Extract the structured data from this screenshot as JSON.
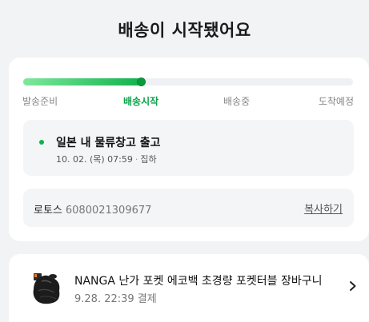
{
  "header": {
    "title": "배송이 시작됐어요"
  },
  "progress": {
    "value": 0.36,
    "steps": [
      "발송준비",
      "배송시작",
      "배송중",
      "도착예정"
    ],
    "active_index": 1,
    "accent_color": "#10b24c"
  },
  "event": {
    "title": "일본 내 물류창고 출고",
    "datetime": "10. 02. (목) 07:59",
    "separator": "·",
    "status": "집하"
  },
  "tracking": {
    "carrier": "로토스",
    "number": "6080021309677",
    "copy_label": "복사하기"
  },
  "order_item": {
    "name": "NANGA 난가 포켓 에코백 초경량 포켓터블 장바구니",
    "date": "9.28. 22:39 결제",
    "thumbnail_icon": "black-pouch-product-image",
    "chevron_icon": "chevron-right-icon"
  }
}
